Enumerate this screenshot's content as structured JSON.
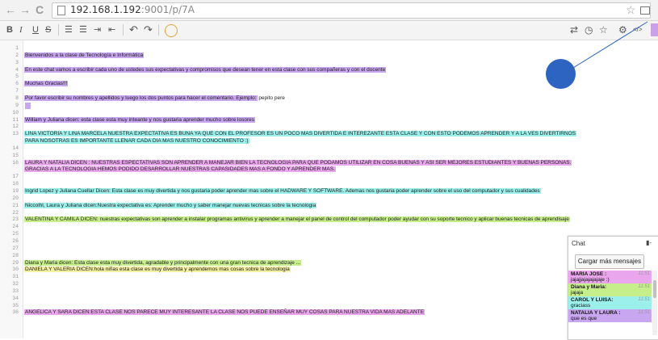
{
  "browser": {
    "back": "←",
    "forward": "→",
    "reload": "C",
    "url_host": "192.168.1.192",
    "url_path": ":9001/p/7A",
    "star": "☆"
  },
  "toolbar": {
    "bold": "B",
    "italic": "I",
    "underline": "U",
    "strike": "S",
    "ordered_list": "☰",
    "unordered_list": "☰",
    "indent": "⇥",
    "outdent": "⇤",
    "undo": "↶",
    "redo": "↷",
    "import_export": "⇄",
    "history": "◷",
    "star": "☆",
    "settings": "⚙",
    "embed": "</>"
  },
  "pad_lines": [
    {
      "n": "1",
      "text": ""
    },
    {
      "n": "2",
      "text": "Bienvenidos a la clase de Tecnología e Informática",
      "color": "purple"
    },
    {
      "n": "3",
      "text": ""
    },
    {
      "n": "4",
      "text": "En este chat vamos a escribir cada uno de ustedes sus expectativas y compromisos que desean tener en esta clase con sus compañeras y con el docente",
      "color": "purple"
    },
    {
      "n": "5",
      "text": ""
    },
    {
      "n": "6",
      "text": "Muchas Gracias!!!",
      "color": "purple"
    },
    {
      "n": "7",
      "text": ""
    },
    {
      "n": "8",
      "text": "Por favor escribir su nombres y apellidos y luego los dos puntos para hacer el comentario. Ejemplo:",
      "color": "purple",
      "extra": " pepito pere"
    },
    {
      "n": "9",
      "text": ""
    },
    {
      "n": "10",
      "text": ""
    },
    {
      "n": "11",
      "text": "     William y Juliana dicen: esta clase esta muy inteante y nos gustaria aprender mucho sobre losores",
      "color": "purple"
    },
    {
      "n": "12",
      "text": ""
    },
    {
      "n": "13",
      "text": "LINA VICTORIA Y LINA MARCELA NUESTRA EXPECTATIVA ES BUNA YA QUE CON EL PROFESOR ES UN POCO MAS DIVERTIDA E INTEREZANTE ESTA CLASE Y CON ESTO PODEMOS APRENDER Y A LA VES DIVERTIRNOS",
      "color": "cyan"
    },
    {
      "n": "",
      "text": "PARA NOSOTRAS ES IMPORTANTE LLENAR CADA DIA MAS NUESTRO CONOCIMIENTO  :)",
      "color": "cyan"
    },
    {
      "n": "14",
      "text": ""
    },
    {
      "n": "15",
      "text": ""
    },
    {
      "n": "16",
      "text": "LAURA Y NATALIA DICEN :  NUESTRAS ESPECTATIVAS SON APRENDER A MANEJAR BIEN LA TECNOLOGIA PARA QUE  PODAMOS UTILIZAR  EN COSA BUENAS Y ASI SER MEJORES ESTUDIANTES Y BUENAS PERSONAS.",
      "color": "pink"
    },
    {
      "n": "",
      "text": "GRACIAS A LA TECNOLOGIA HEMOS PODIDO DESARROLLAR NUESTRAS CAPASIDADES MAS A FONDO Y APRENDER MAS.",
      "color": "pink"
    },
    {
      "n": "17",
      "text": ""
    },
    {
      "n": "18",
      "text": ""
    },
    {
      "n": "19",
      "text": "Ingrid Lopez y Juliana Cuellar Dicen: Esta clase es muy divertida y nos gustaria poder aprender mas sobre el HADWARE Y SOFTWARE.  Ademas nos gustaria poder aprender sobre el uso del computador y sus cualidades",
      "color": "cyan"
    },
    {
      "n": "20",
      "text": ""
    },
    {
      "n": "21",
      "text": "Niccolhl, Laura y Juliana dicen:Nuestra expectativa es: Aprender mucho y saber manejar nuevas tecnicas sobre la tecnologia",
      "color": "cyan"
    },
    {
      "n": "22",
      "text": ""
    },
    {
      "n": "23",
      "text": "VALENTINA Y CAMILA DICEN: nuestras expectativas son aprender a instalar programas antivirus y aprender a manejar el panel de control del computador poder ayudar con su soporte tecnico y aplicar  buenas tecnicas de aprendisaje",
      "color": "green"
    },
    {
      "n": "24",
      "text": ""
    },
    {
      "n": "25",
      "text": ""
    },
    {
      "n": "26",
      "text": ""
    },
    {
      "n": "27",
      "text": ""
    },
    {
      "n": "28",
      "text": ""
    },
    {
      "n": "29",
      "text": "Diana y Maria dicen:  Esta clase esta muy divertida, agradable y principalmente con una gran tecnica de aprendizaje ...",
      "color": "green"
    },
    {
      "n": "30",
      "text": "DANIELA Y VALERIA DICEN:hola niñas esta clase es muy divertida y aprendemos mas cosas sobre la tecnologia",
      "color": "yellow"
    },
    {
      "n": "31",
      "text": ""
    },
    {
      "n": "32",
      "text": ""
    },
    {
      "n": "33",
      "text": ""
    },
    {
      "n": "34",
      "text": ""
    },
    {
      "n": "35",
      "text": ""
    },
    {
      "n": "36",
      "text": "ANGELICA Y SARA DICEN:ESTA CLASE NOS PARECE MUY INTERESANTE LA CLASE NOS PUEDE ENSEÑAR MUY COSAS PARA NUESTRA VIDA MAS ADELANTE",
      "color": "pink"
    }
  ],
  "chat": {
    "title": "Chat",
    "minimize": "▮-",
    "load_more": "Cargar más mensajes",
    "messages": [
      {
        "author": "MARIA JOSE :",
        "time": "11:51",
        "text": "jajajjajajajajaje :)",
        "color": "#e9a6ec"
      },
      {
        "author": "Diana y Maria:",
        "time": "11:51",
        "text": "jajaja",
        "color": "#c6ef8c"
      },
      {
        "author": "CAROL Y LUISA:",
        "time": "11:51",
        "text": "graciass",
        "color": "#9cf0ec"
      },
      {
        "author": "NATALIA Y LAURA :",
        "time": "11:51",
        "text": "que es que",
        "color": "#c9a6f0"
      }
    ]
  },
  "colors": {
    "purple": "#c9a6f0",
    "cyan": "#9cf0ec",
    "pink": "#e9a6ec",
    "green": "#c6ef8c",
    "yellow": "#f3f0a2",
    "cursor": "#2d64c2"
  }
}
